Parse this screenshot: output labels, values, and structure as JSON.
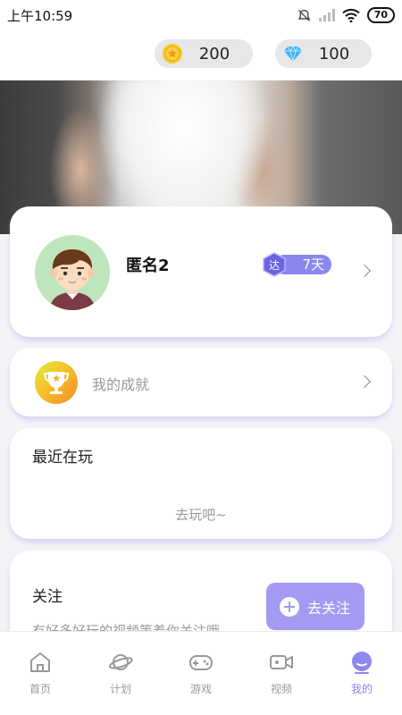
{
  "status_bar": {
    "time": "上午10:59",
    "battery": "70"
  },
  "header": {
    "coins": "200",
    "diamonds": "100"
  },
  "profile": {
    "username": "匿名2",
    "badge_icon_text": "达",
    "badge_days": "7天"
  },
  "achievement": {
    "label": "我的成就"
  },
  "recent": {
    "title": "最近在玩",
    "cta": "去玩吧~"
  },
  "follow": {
    "title": "关注",
    "description": "有好多好玩的视频等着你关注哦",
    "button": "去关注"
  },
  "tabs": [
    {
      "label": "首页",
      "icon": "home-icon"
    },
    {
      "label": "计划",
      "icon": "planet-icon"
    },
    {
      "label": "游戏",
      "icon": "gamepad-icon"
    },
    {
      "label": "视频",
      "icon": "video-icon"
    },
    {
      "label": "我的",
      "icon": "profile-icon",
      "active": true
    }
  ],
  "colors": {
    "accent": "#8d87f0",
    "button": "#a39af2",
    "coin": "#f7c81e",
    "diamond": "#3fb2f0"
  }
}
